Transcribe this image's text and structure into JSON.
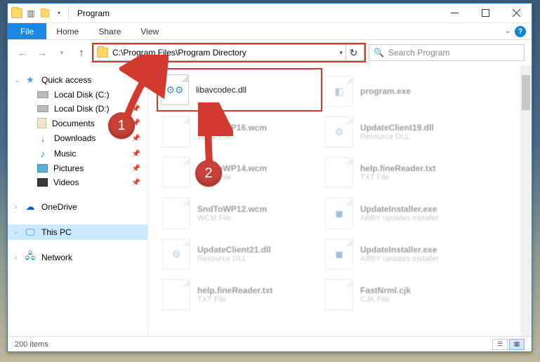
{
  "window": {
    "title": "Program"
  },
  "ribbon": {
    "file": "File",
    "tabs": [
      "Home",
      "Share",
      "View"
    ]
  },
  "address": {
    "path": "C:\\Program Files\\Program Directory",
    "search_placeholder": "Search Program"
  },
  "sidebar": {
    "quick_access": "Quick access",
    "items": [
      {
        "label": "Local Disk (C:)",
        "icon": "disk"
      },
      {
        "label": "Local Disk (D:)",
        "icon": "disk"
      },
      {
        "label": "Documents",
        "icon": "doc"
      },
      {
        "label": "Downloads",
        "icon": "dl"
      },
      {
        "label": "Music",
        "icon": "music"
      },
      {
        "label": "Pictures",
        "icon": "pic"
      },
      {
        "label": "Videos",
        "icon": "vid"
      }
    ],
    "onedrive": "OneDrive",
    "thispc": "This PC",
    "network": "Network"
  },
  "files": {
    "highlighted": {
      "name": "libavcodec.dll",
      "type": ""
    },
    "list": [
      {
        "name": "program.exe",
        "type": ""
      },
      {
        "name": "SndToWP16.wcm",
        "type": "WCM File"
      },
      {
        "name": "UpdateClient19.dll",
        "type": "Resource DLL"
      },
      {
        "name": "SndToWP14.wcm",
        "type": "WCM File"
      },
      {
        "name": "help.fineReader.txt",
        "type": "TXT File"
      },
      {
        "name": "SndToWP12.wcm",
        "type": "WCM File"
      },
      {
        "name": "UpdateInstaller.exe",
        "type": "ABBY updates installer"
      },
      {
        "name": "UpdateClient21.dll",
        "type": "Resource DLL"
      },
      {
        "name": "UpdateInstaller.exe",
        "type": "ABBY updates installer"
      },
      {
        "name": "help.fineReader.txt",
        "type": "TXT File"
      },
      {
        "name": "FastNrml.cjk",
        "type": "CJK File"
      }
    ]
  },
  "statusbar": {
    "count": "200 items"
  },
  "annotations": {
    "one": "1",
    "two": "2"
  }
}
